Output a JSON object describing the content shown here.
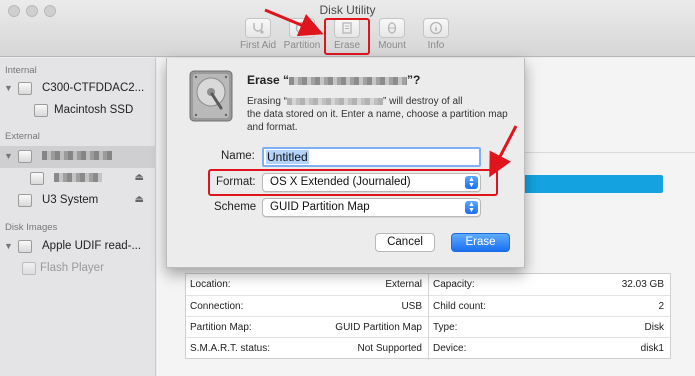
{
  "window": {
    "title": "Disk Utility"
  },
  "toolbar": {
    "tools": [
      {
        "label": "First Aid",
        "icon": "stethoscope-icon"
      },
      {
        "label": "Partition",
        "icon": "partition-icon"
      },
      {
        "label": "Erase",
        "icon": "erase-icon"
      },
      {
        "label": "Mount",
        "icon": "mount-icon"
      },
      {
        "label": "Info",
        "icon": "info-icon"
      }
    ]
  },
  "sidebar": {
    "sections": [
      {
        "title": "Internal"
      },
      {
        "title": "External"
      },
      {
        "title": "Disk Images"
      }
    ],
    "items": [
      {
        "label": "C300-CTFDDAC2..."
      },
      {
        "label": "Macintosh SSD"
      },
      {
        "label": ""
      },
      {
        "label": ""
      },
      {
        "label": "U3 System"
      },
      {
        "label": "Apple UDIF read-..."
      },
      {
        "label": "Flash Player"
      }
    ]
  },
  "dialog": {
    "title_prefix": "Erase “",
    "title_suffix": "”?",
    "message_line1_prefix": "Erasing “",
    "message_line1_suffix": "” will destroy of all",
    "message_line2": "the data stored on it. Enter a name, choose a partition map",
    "message_line3": "and format.",
    "name_label": "Name:",
    "name_value": "Untitled",
    "format_label": "Format:",
    "format_value": "OS X Extended (Journaled)",
    "scheme_label": "Scheme",
    "scheme_value": "GUID Partition Map",
    "cancel_label": "Cancel",
    "erase_label": "Erase"
  },
  "info": {
    "left": [
      {
        "key": "Location:",
        "value": "External"
      },
      {
        "key": "Connection:",
        "value": "USB"
      },
      {
        "key": "Partition Map:",
        "value": "GUID Partition Map"
      },
      {
        "key": "S.M.A.R.T. status:",
        "value": "Not Supported"
      }
    ],
    "right": [
      {
        "key": "Capacity:",
        "value": "32.03 GB"
      },
      {
        "key": "Child count:",
        "value": "2"
      },
      {
        "key": "Type:",
        "value": "Disk"
      },
      {
        "key": "Device:",
        "value": "disk1"
      }
    ]
  },
  "colors": {
    "highlight": "#e0141c",
    "accent": "#1a6ff0",
    "usage_bar": "#14a3e0"
  }
}
